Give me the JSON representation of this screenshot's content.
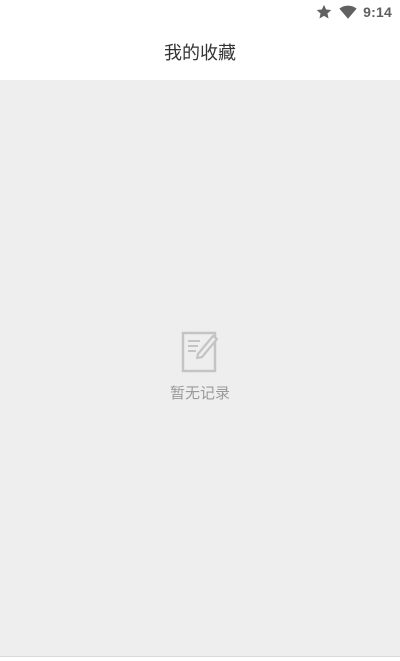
{
  "status_bar": {
    "time": "9:14",
    "icons": [
      "star-icon",
      "wifi-icon"
    ]
  },
  "header": {
    "title": "我的收藏"
  },
  "empty_state": {
    "icon": "note-edit-icon",
    "message": "暂无记录"
  },
  "colors": {
    "content_background": "#eeeeee",
    "header_background": "#ffffff",
    "title_text": "#333333",
    "empty_text": "#9a9a9a",
    "icon_gray": "#c4c4c4"
  }
}
